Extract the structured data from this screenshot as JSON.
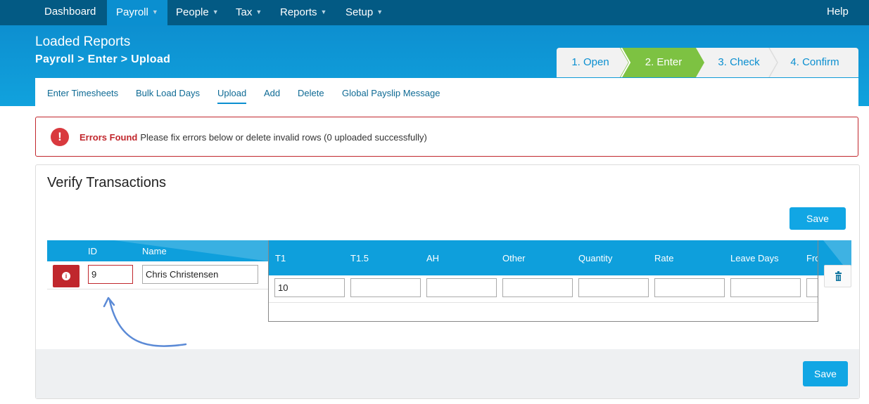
{
  "nav": {
    "items": [
      {
        "label": "Dashboard"
      },
      {
        "label": "Payroll",
        "active": true
      },
      {
        "label": "People"
      },
      {
        "label": "Tax"
      },
      {
        "label": "Reports"
      },
      {
        "label": "Setup"
      }
    ],
    "help": "Help",
    "caret_icon": "caret-down-icon"
  },
  "header": {
    "title": "Loaded Reports",
    "breadcrumb": "Payroll > Enter > Upload"
  },
  "wizard": {
    "steps": [
      "1. Open",
      "2. Enter",
      "3. Check",
      "4. Confirm"
    ],
    "active_index": 1,
    "active_color": "#7dc242"
  },
  "subnav": {
    "tabs": [
      "Enter Timesheets",
      "Bulk Load Days",
      "Upload",
      "Add",
      "Delete",
      "Global Payslip Message"
    ],
    "active_index": 2
  },
  "error": {
    "icon": "exclamation-circle-icon",
    "title": "Errors Found",
    "message": "Please fix errors below or delete invalid rows (0 uploaded successfully)"
  },
  "verify": {
    "title": "Verify Transactions",
    "save_top": "Save",
    "save_bottom": "Save"
  },
  "table": {
    "fixed_columns": [
      "ID",
      "Name"
    ],
    "columns": [
      "T1",
      "T1.5",
      "AH",
      "Other",
      "Quantity",
      "Rate",
      "Leave Days",
      "Fro"
    ],
    "row": {
      "info_icon": "info-icon",
      "id": "9",
      "name": "Chris Christensen",
      "values": [
        "10",
        "",
        "",
        "",
        "",
        "",
        "",
        ""
      ],
      "delete_icon": "trash-icon"
    }
  },
  "colors": {
    "nav": "#035a84",
    "header_accent": "#0e9fdc",
    "error": "#c0272d",
    "save_button": "#11a6e4",
    "annotation_arrow": "#5b8ad6"
  }
}
